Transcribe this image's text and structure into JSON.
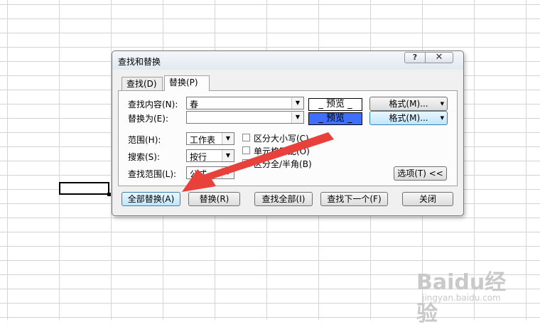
{
  "dialog": {
    "title": "查找和替换",
    "help_button": "?",
    "close_button": "✕",
    "tabs": [
      {
        "label": "查找(D)",
        "active": false
      },
      {
        "label": "替换(P)",
        "active": true
      }
    ],
    "find_label": "查找内容(N):",
    "find_value": "春",
    "replace_label": "替换为(E):",
    "replace_value": "",
    "preview_text": "_ 预览 _",
    "format_button": "格式(M)...",
    "scope_label": "范围(H):",
    "scope_value": "工作表",
    "search_label": "搜索(S):",
    "search_value": "按行",
    "lookin_label": "查找范围(L):",
    "lookin_value": "公式",
    "options": [
      {
        "label": "区分大小写(C)",
        "checked": false
      },
      {
        "label": "单元格匹配(O)",
        "checked": false
      },
      {
        "label": "区分全/半角(B)",
        "checked": false
      }
    ],
    "options_button": "选项(T) <<",
    "buttons": {
      "replace_all": "全部替换(A)",
      "replace": "替换(R)",
      "find_all": "查找全部(I)",
      "find_next": "查找下一个(F)",
      "close": "关闭"
    }
  },
  "annotation": {
    "arrow_color": "#e8413b"
  },
  "watermark": {
    "brand": "Baidu经验",
    "url": "jingyan.baidu.com"
  }
}
